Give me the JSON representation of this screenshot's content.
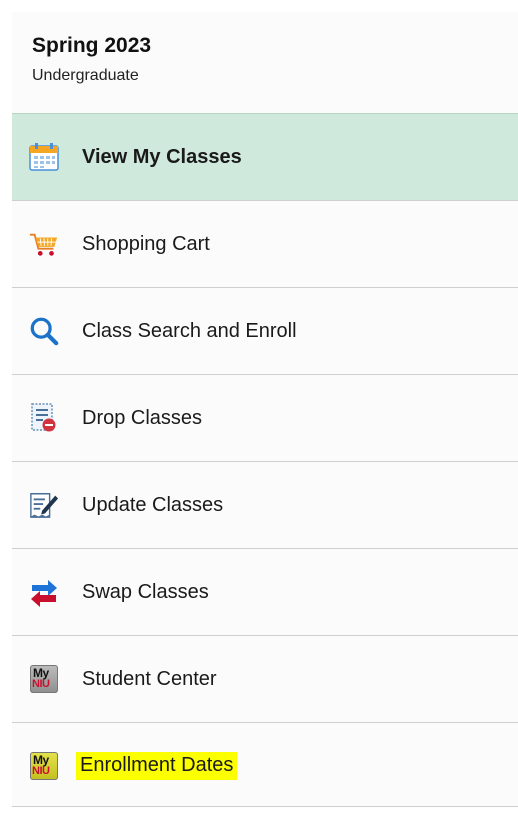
{
  "term": {
    "title": "Spring 2023",
    "level": "Undergraduate"
  },
  "nav": {
    "items": [
      {
        "label": "View My Classes",
        "icon": "calendar-icon",
        "selected": true
      },
      {
        "label": "Shopping Cart",
        "icon": "cart-icon"
      },
      {
        "label": "Class Search and Enroll",
        "icon": "search-icon"
      },
      {
        "label": "Drop Classes",
        "icon": "drop-document-icon"
      },
      {
        "label": "Update Classes",
        "icon": "edit-document-icon"
      },
      {
        "label": "Swap Classes",
        "icon": "swap-arrows-icon"
      },
      {
        "label": "Student Center",
        "icon": "myniu-logo-icon"
      },
      {
        "label": "Enrollment Dates",
        "icon": "myniu-logo-icon",
        "highlighted": true
      }
    ],
    "logo_text_top": "My",
    "logo_text_bottom": "NIU"
  },
  "colors": {
    "selected_background": "#cfe9dc",
    "highlight": "#fbff00",
    "search_blue": "#1a73c9",
    "swap_blue": "#1e73d6",
    "swap_red": "#c8102e",
    "cart_orange": "#f39c12"
  }
}
